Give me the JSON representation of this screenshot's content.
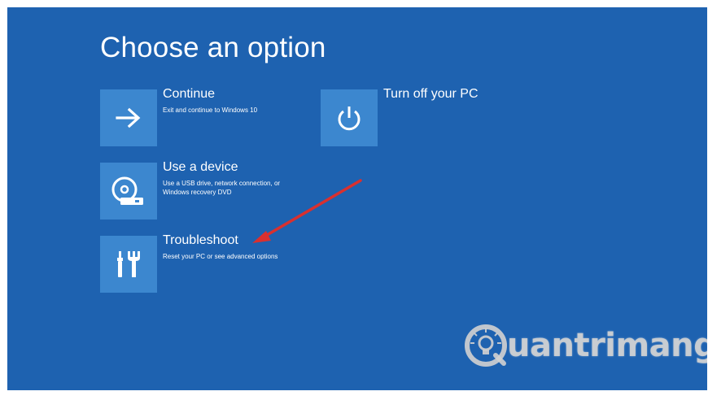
{
  "page": {
    "title": "Choose an option"
  },
  "options": [
    {
      "title": "Continue",
      "description": "Exit and continue to Windows 10",
      "icon": "arrow-right-icon"
    },
    {
      "title": "Use a device",
      "description": "Use a USB drive, network connection, or Windows recovery DVD",
      "icon": "disc-drive-icon"
    },
    {
      "title": "Troubleshoot",
      "description": "Reset your PC or see advanced options",
      "icon": "tools-icon"
    },
    {
      "title": "Turn off your PC",
      "description": "",
      "icon": "power-icon"
    }
  ],
  "annotation": {
    "icon": "red-arrow-pointer",
    "color": "#d9302f"
  },
  "watermark": {
    "text": "uantrimang",
    "icon": "lightbulb-q-logo"
  },
  "colors": {
    "background": "#1e62b0",
    "tile": "#3c87cf",
    "text": "#ffffff"
  }
}
